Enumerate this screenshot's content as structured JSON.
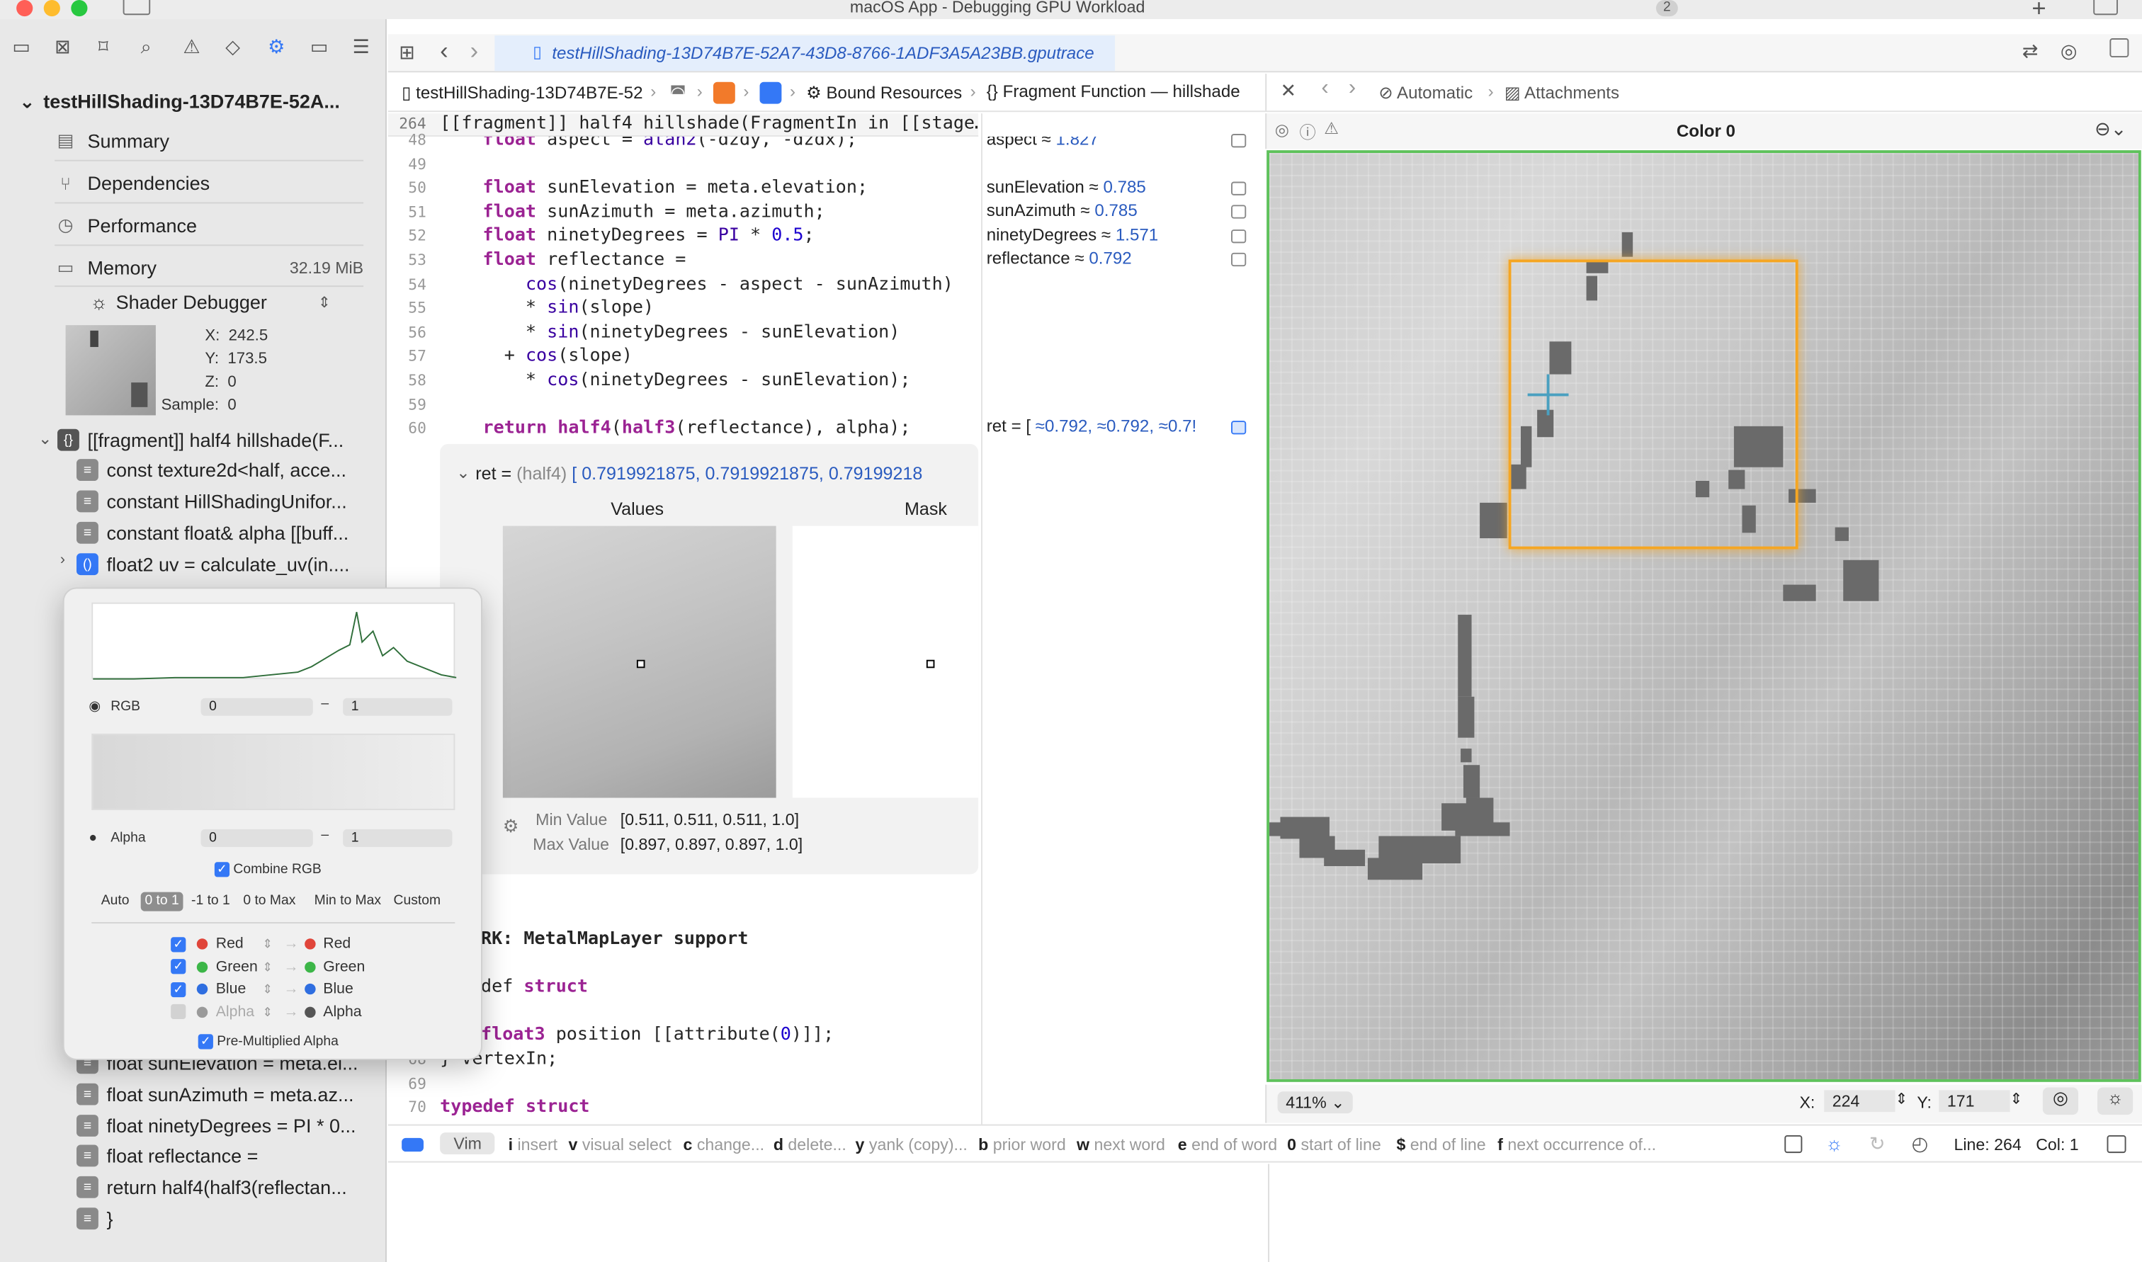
{
  "window": {
    "title": "macOS App - Debugging GPU Workload",
    "badge": "2"
  },
  "sidebar": {
    "root_label": "testHillShading-13D74B7E-52A...",
    "nav": [
      {
        "label": "Summary",
        "value": ""
      },
      {
        "label": "Dependencies",
        "value": ""
      },
      {
        "label": "Performance",
        "value": ""
      },
      {
        "label": "Memory",
        "value": "32.19 MiB"
      }
    ],
    "shader_debugger": "Shader Debugger",
    "pixel_info": {
      "x": "X:",
      "x_val": "242.5",
      "y": "Y:",
      "y_val": "173.5",
      "z": "Z:",
      "z_val": "0",
      "sample": "Sample:",
      "sample_val": "0"
    },
    "tree": [
      "[[fragment]] half4 hillshade(F...",
      "const texture2d<half, acce...",
      "constant HillShadingUnifor...",
      "constant float& alpha [[buff...",
      "float2 uv = calculate_uv(in....",
      "float sunElevation = meta.el...",
      "float sunAzimuth = meta.az...",
      "float ninetyDegrees = PI * 0...",
      "float reflectance =",
      "return half4(half3(reflectan...",
      "}"
    ]
  },
  "tab": {
    "label": "testHillShading-13D74B7E-52A7-43D8-8766-1ADF3A5A23BB.gputrace"
  },
  "crumbs": {
    "file": "testHillShading-13D74B7E-52",
    "bound": "Bound Resources",
    "fragment": "Fragment Function — hillshade"
  },
  "right_crumbs": {
    "automatic": "Automatic",
    "attachments": "Attachments"
  },
  "sticky": {
    "line": "264",
    "text": "[[fragment]] half4 hillshade(FragmentIn in [[stage…"
  },
  "code_lines": [
    {
      "no": "48",
      "text": "    float aspect = atan2(-dzdy, -dzdx);"
    },
    {
      "no": "49",
      "text": ""
    },
    {
      "no": "50",
      "text": "    float sunElevation = meta.elevation;"
    },
    {
      "no": "51",
      "text": "    float sunAzimuth = meta.azimuth;"
    },
    {
      "no": "52",
      "text": "    float ninetyDegrees = PI * 0.5;"
    },
    {
      "no": "53",
      "text": "    float reflectance ="
    },
    {
      "no": "54",
      "text": "        cos(ninetyDegrees - aspect - sunAzimuth)"
    },
    {
      "no": "55",
      "text": "        * sin(slope)"
    },
    {
      "no": "56",
      "text": "        * sin(ninetyDegrees - sunElevation)"
    },
    {
      "no": "57",
      "text": "      + cos(slope)"
    },
    {
      "no": "58",
      "text": "        * cos(ninetyDegrees - sunElevation);"
    },
    {
      "no": "59",
      "text": ""
    },
    {
      "no": "60",
      "text": "    return half4(half3(reflectance), alpha);"
    }
  ],
  "lower_code": [
    {
      "no": "",
      "text": "RK: MetalMapLayer support"
    },
    {
      "no": "",
      "text": "def struct"
    },
    {
      "no": "",
      "text": "float3 position [[attribute(0)]];"
    },
    {
      "no": "68",
      "text": "} VertexIn;"
    },
    {
      "no": "69",
      "text": ""
    },
    {
      "no": "70",
      "text": "typedef struct"
    }
  ],
  "annotations": [
    {
      "name": "aspect ≈",
      "value": "1.827"
    },
    {
      "name": "sunElevation ≈",
      "value": "0.785"
    },
    {
      "name": "sunAzimuth ≈",
      "value": "0.785"
    },
    {
      "name": "ninetyDegrees ≈",
      "value": "1.571"
    },
    {
      "name": "reflectance ≈",
      "value": "0.792"
    },
    {
      "name": "ret = [",
      "value": "≈0.792, ≈0.792, ≈0.7!"
    }
  ],
  "ret_panel": {
    "label": "ret =",
    "type": "(half4)",
    "values": "[ 0.7919921875, 0.7919921875, 0.79199218",
    "col_values": "Values",
    "col_mask": "Mask",
    "min_label": "Min Value",
    "min_val": "[0.511, 0.511, 0.511, 1.0]",
    "max_label": "Max Value",
    "max_val": "[0.897, 0.897, 0.897, 1.0]"
  },
  "right_pane": {
    "title": "Color 0",
    "zoom": "411%",
    "x_label": "X:",
    "x_val": "224",
    "y_label": "Y:",
    "y_val": "171"
  },
  "histogram": {
    "rgb_label": "RGB",
    "rgb_min": "0",
    "rgb_max": "1",
    "alpha_label": "Alpha",
    "alpha_min": "0",
    "alpha_max": "1",
    "dash": "–",
    "combine": "Combine RGB",
    "ranges": [
      "Auto",
      "0 to 1",
      "-1 to 1",
      "0 to Max",
      "Min to Max",
      "Custom"
    ],
    "selected_range": "0 to 1",
    "channels": [
      {
        "from": "Red",
        "to": "Red",
        "color": "#e0453a",
        "checked": true
      },
      {
        "from": "Green",
        "to": "Green",
        "color": "#3cb648",
        "checked": true
      },
      {
        "from": "Blue",
        "to": "Blue",
        "color": "#2f6ee0",
        "checked": true
      },
      {
        "from": "Alpha",
        "to": "Alpha",
        "color": "#9a9a9a",
        "checked": false
      }
    ],
    "premult": "Pre-Multiplied Alpha"
  },
  "statusbar": {
    "vim": "Vim",
    "hints": [
      {
        "k": "i",
        "t": "insert"
      },
      {
        "k": "v",
        "t": "visual select"
      },
      {
        "k": "c",
        "t": "change..."
      },
      {
        "k": "d",
        "t": "delete..."
      },
      {
        "k": "y",
        "t": "yank (copy)..."
      },
      {
        "k": "b",
        "t": "prior word"
      },
      {
        "k": "w",
        "t": "next word"
      },
      {
        "k": "e",
        "t": "end of word"
      },
      {
        "k": "0",
        "t": "start of line"
      },
      {
        "k": "$",
        "t": "end of line"
      },
      {
        "k": "f",
        "t": "next occurrence of..."
      }
    ],
    "line": "Line: 264",
    "col": "Col: 1"
  }
}
